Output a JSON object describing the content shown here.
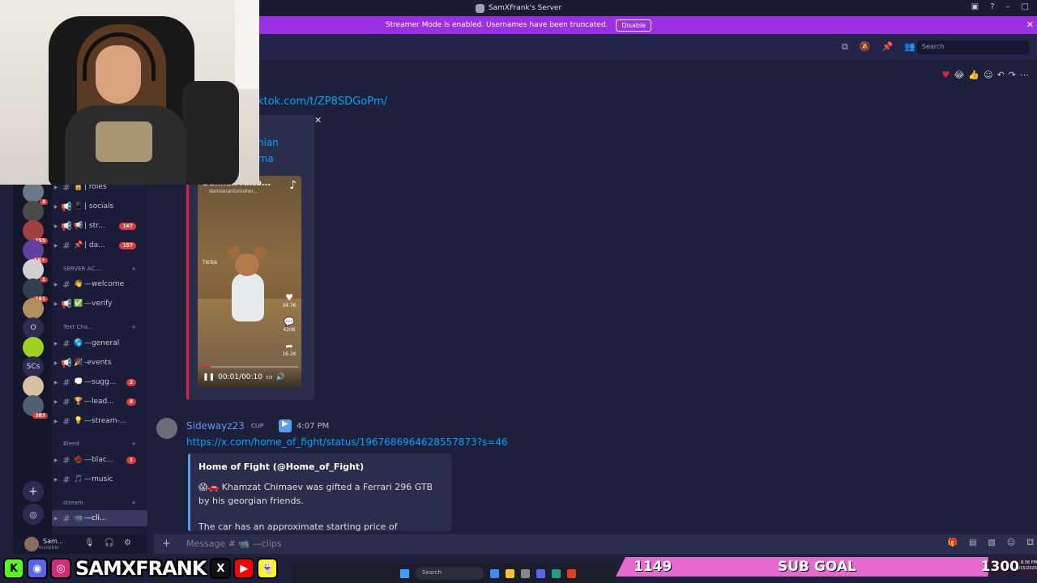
{
  "window": {
    "title": "SamXFrank's Server"
  },
  "streamer_mode": {
    "text": "Streamer Mode is enabled. Usernames have been truncated.",
    "button": "Disable"
  },
  "header": {
    "search_placeholder": "Search"
  },
  "servers": [
    {
      "badge": "3",
      "color": "#6a7a8a"
    },
    {
      "badge": "",
      "color": "#4a4a4a"
    },
    {
      "badge": "355",
      "color": "#a04040"
    },
    {
      "badge": "1K+",
      "color": "#6040a0"
    },
    {
      "badge": "1",
      "color": "#d0d0d0"
    },
    {
      "badge": "161",
      "color": "#304050"
    },
    {
      "badge": "",
      "color": "#b09060"
    },
    {
      "badge": "",
      "color": "#2a2c52",
      "text": "O"
    },
    {
      "badge": "",
      "color": "#a0d020"
    },
    {
      "badge": "",
      "color": "#2a2c52",
      "text": "SCs"
    },
    {
      "badge": "",
      "color": "#d8c0a0"
    },
    {
      "badge": "387",
      "color": "#506070"
    }
  ],
  "channels": [
    {
      "emoji": "🔒",
      "name": "| roles",
      "badge": "",
      "type": "text"
    },
    {
      "emoji": "📱",
      "name": "| socials",
      "badge": "",
      "type": "announce"
    },
    {
      "emoji": "📢",
      "name": "| str...",
      "badge": "147",
      "type": "announce"
    },
    {
      "emoji": "📌",
      "name": "| da...",
      "badge": "157",
      "type": "text"
    }
  ],
  "category_server": "SERVER AC...",
  "channels_server": [
    {
      "emoji": "👋",
      "name": "—welcome",
      "badge": "",
      "type": "text"
    },
    {
      "emoji": "✅",
      "name": "—verify",
      "badge": "",
      "type": "announce"
    }
  ],
  "category_text": "Text Cha...",
  "channels_text": [
    {
      "emoji": "🌎",
      "name": "—general",
      "badge": "",
      "type": "text"
    },
    {
      "emoji": "🎉",
      "name": "-events",
      "badge": "",
      "type": "announce"
    },
    {
      "emoji": "💭",
      "name": "—sugg...",
      "badge": "2",
      "type": "text"
    },
    {
      "emoji": "🏆",
      "name": "—lead...",
      "badge": "8",
      "type": "text"
    },
    {
      "emoji": "💡",
      "name": "—stream-...",
      "badge": "",
      "type": "text"
    }
  ],
  "category_bleed": "Bleed",
  "channels_bleed": [
    {
      "emoji": "🌰",
      "name": "—blac...",
      "badge": "1",
      "type": "text"
    },
    {
      "emoji": "🎵",
      "name": "—music",
      "badge": "",
      "type": "text"
    }
  ],
  "category_stream": "stream",
  "channels_stream": [
    {
      "emoji": "📹",
      "name": "—cli...",
      "badge": "",
      "type": "text",
      "active": true
    }
  ],
  "user": {
    "name": "Sam...",
    "status": "Invisible"
  },
  "message1": {
    "link": "ktok.com/t/ZP8SDGoPm/",
    "embed_frag1": "nian",
    "embed_frag2": "rna",
    "video": {
      "author": "Damian Anto...",
      "handle": "damianantonioher...",
      "watermark": "TikTok",
      "likes": "34.7K",
      "comments": "4206",
      "shares": "16.2K",
      "time": "00:01/00:10",
      "progress": 0.1
    }
  },
  "message2": {
    "author": "Sidewayz23",
    "tag": "CLIP",
    "time": "4:07 PM",
    "link": "https://x.com/home_of_fight/status/1967686964628557873?s=46",
    "embed_title": "Home of Fight (@Home_of_Fight)",
    "embed_body": "😱🚗 Khamzat Chimaev was gifted a Ferrari 296 GTB by his georgian friends.",
    "embed_body2": "The car has an approximate starting price of"
  },
  "composer": {
    "placeholder": "Message # 📹 —clips"
  },
  "overlay": {
    "streamer_name": "SAMXFRANK",
    "sub_current": "1149",
    "sub_label": "SUB GOAL",
    "sub_goal": "1300",
    "sub_progress": 0.884,
    "clock_time": "8:36 PM",
    "clock_date": "9/15/2025"
  },
  "taskbar": {
    "search": "Search"
  }
}
